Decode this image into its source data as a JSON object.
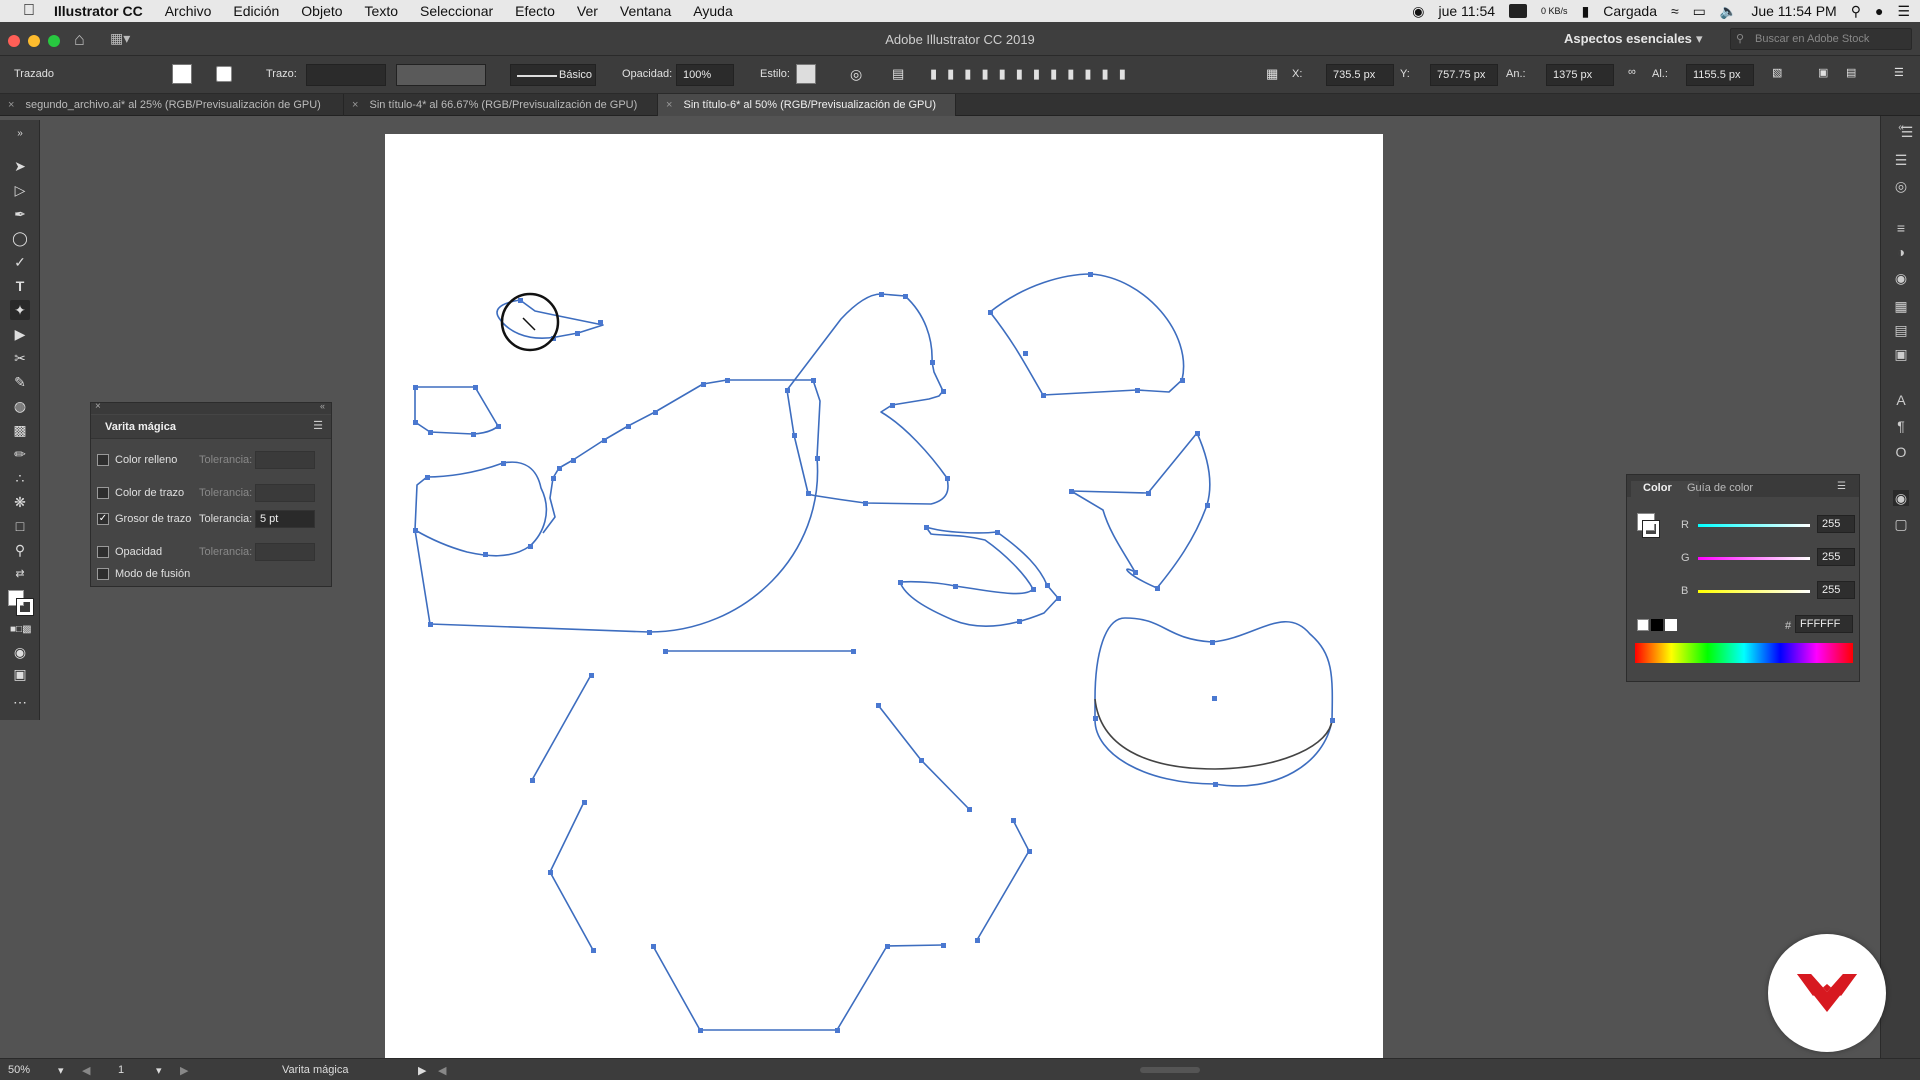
{
  "menubar": {
    "app_name": "Illustrator CC",
    "items": [
      "Archivo",
      "Edición",
      "Objeto",
      "Texto",
      "Seleccionar",
      "Efecto",
      "Ver",
      "Ventana",
      "Ayuda"
    ],
    "clock_short": "jue 11:54",
    "net_speed": "0 KB/s",
    "battery_text": "Cargada",
    "clock_long": "Jue 11:54 PM"
  },
  "window": {
    "title": "Adobe Illustrator CC 2019",
    "workspace": "Aspectos esenciales",
    "stock_search_placeholder": "Buscar en Adobe Stock"
  },
  "controlbar": {
    "selection_type": "Trazado",
    "stroke_label": "Trazo:",
    "brush_name": "Básico",
    "opacity_label": "Opacidad:",
    "opacity_value": "100%",
    "style_label": "Estilo:",
    "x_label": "X:",
    "x_value": "735.5 px",
    "y_label": "Y:",
    "y_value": "757.75 px",
    "w_label": "An.:",
    "w_value": "1375 px",
    "h_label": "Al.:",
    "h_value": "1155.5 px"
  },
  "tabs": [
    {
      "label": "segundo_archivo.ai* al 25% (RGB/Previsualización de GPU)"
    },
    {
      "label": "Sin título-4* al 66.67% (RGB/Previsualización de GPU)"
    },
    {
      "label": "Sin título-6* al 50% (RGB/Previsualización de GPU)"
    }
  ],
  "magic_wand": {
    "title": "Varita mágica",
    "tolerance_label": "Tolerancia:",
    "rows": [
      {
        "label": "Color relleno",
        "checked": false,
        "tolerance": ""
      },
      {
        "label": "Color de trazo",
        "checked": false,
        "tolerance": ""
      },
      {
        "label": "Grosor de trazo",
        "checked": true,
        "tolerance": "5 pt"
      },
      {
        "label": "Opacidad",
        "checked": false,
        "tolerance": ""
      },
      {
        "label": "Modo de fusión",
        "checked": false,
        "tolerance": null
      }
    ]
  },
  "color_panel": {
    "tab_color": "Color",
    "tab_guide": "Guía de color",
    "r_label": "R",
    "r_value": "255",
    "g_label": "G",
    "g_value": "255",
    "b_label": "B",
    "b_value": "255",
    "hex_label": "#",
    "hex_value": "FFFFFF"
  },
  "statusbar": {
    "zoom": "50%",
    "artboard_number": "1",
    "current_tool": "Varita mágica"
  },
  "colors": {
    "path_blue": "#3d6dbf",
    "anchor_blue": "#4a78d0",
    "brand_red": "#d71920"
  }
}
